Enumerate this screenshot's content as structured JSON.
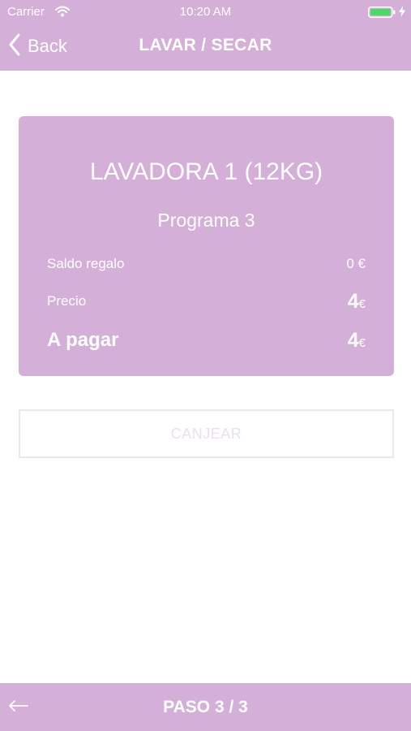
{
  "status_bar": {
    "carrier": "Carrier",
    "time": "10:20 AM",
    "icons": [
      "wifi-icon",
      "battery-icon",
      "charging-bolt-icon"
    ]
  },
  "nav": {
    "back_label": "Back",
    "title": "LAVAR / SECAR",
    "icons": [
      "chevron-left-icon"
    ]
  },
  "card": {
    "title": "LAVADORA 1 (12KG)",
    "subtitle": "Programa 3",
    "rows": [
      {
        "label": "Saldo regalo",
        "value": "0 €"
      },
      {
        "label": "Precio",
        "amount": "4",
        "currency": "€"
      },
      {
        "label": "A pagar",
        "amount": "4",
        "currency": "€"
      }
    ]
  },
  "actions": {
    "redeem_label": "CANJEAR"
  },
  "footer": {
    "step_label": "PASO 3 / 3",
    "icons": [
      "arrow-left-icon"
    ]
  },
  "colors": {
    "accent": "#d4afd8",
    "background": "#ffffff",
    "disabled_button": "#ecdff0"
  }
}
